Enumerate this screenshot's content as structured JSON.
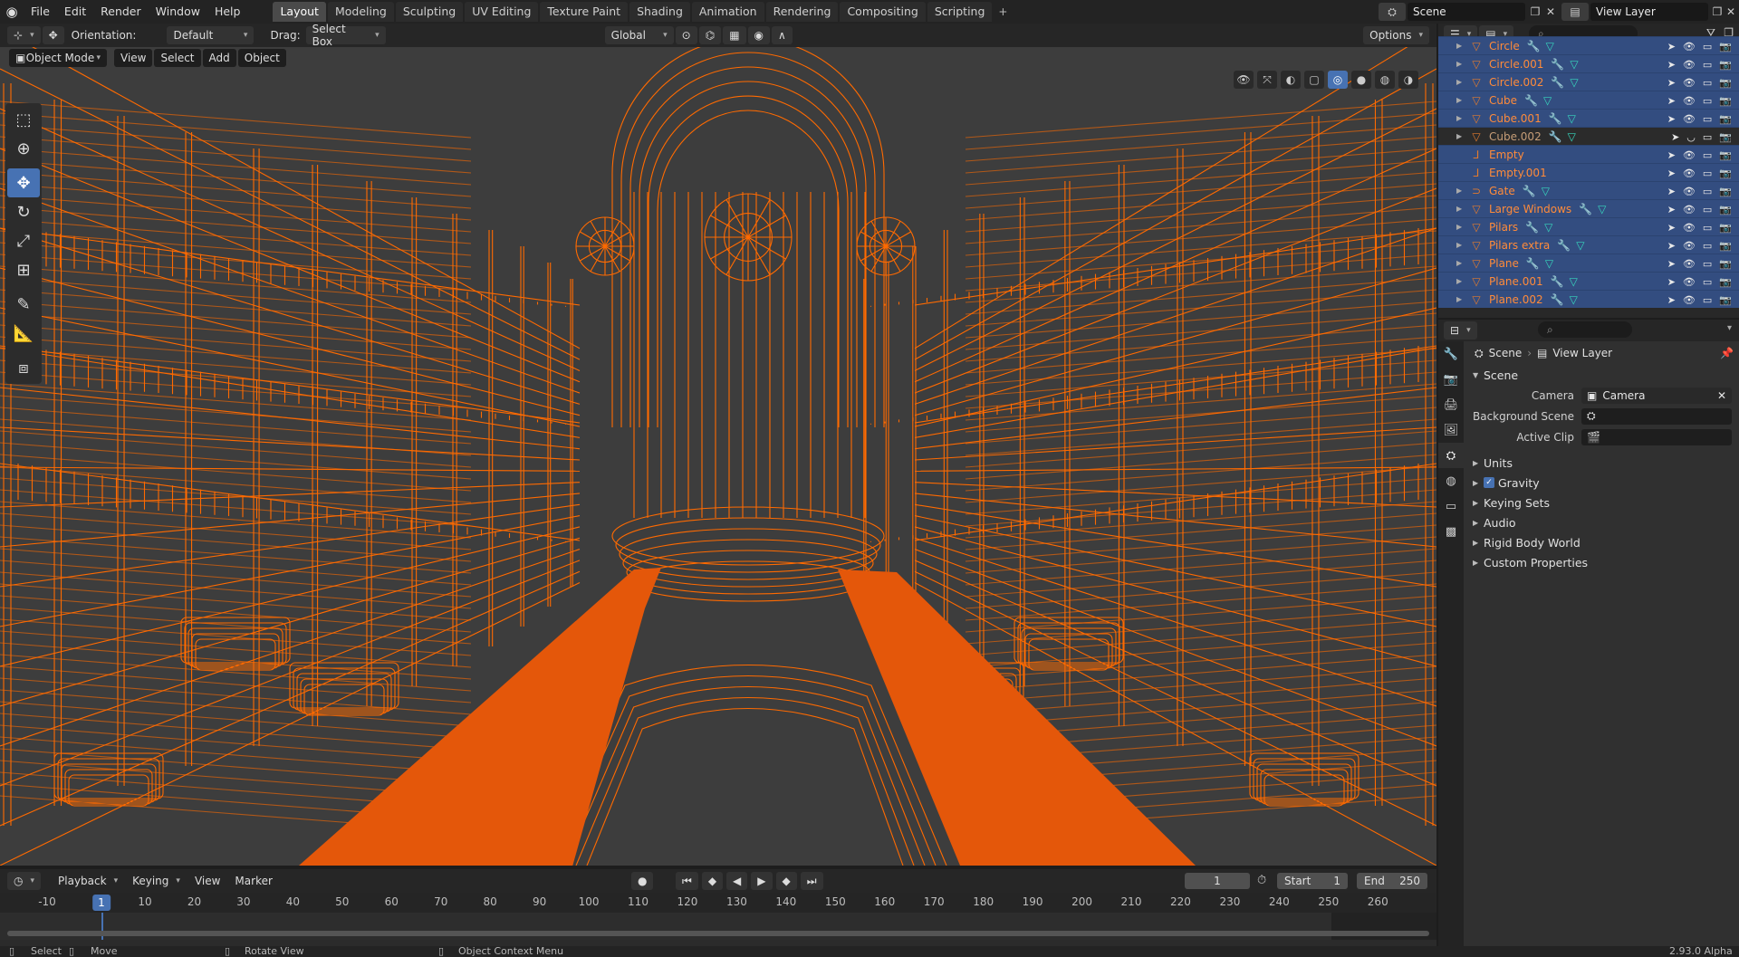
{
  "topbar": {
    "menus": [
      "File",
      "Edit",
      "Render",
      "Window",
      "Help"
    ],
    "workspaces": [
      "Layout",
      "Modeling",
      "Sculpting",
      "UV Editing",
      "Texture Paint",
      "Shading",
      "Animation",
      "Rendering",
      "Compositing",
      "Scripting"
    ],
    "active_workspace": "Layout",
    "add_tab": "+",
    "scene": "Scene",
    "view_layer": "View Layer"
  },
  "tool_header": {
    "orientation_label": "Orientation:",
    "orientation_value": "Default",
    "drag_label": "Drag:",
    "drag_value": "Select Box",
    "transform_orientation": "Global",
    "options": "Options"
  },
  "viewport_header": {
    "mode": "Object Mode",
    "menus": [
      "View",
      "Select",
      "Add",
      "Object"
    ]
  },
  "timeline": {
    "menus": [
      "Playback",
      "Keying",
      "View",
      "Marker"
    ],
    "current_frame": "1",
    "start_label": "Start",
    "start": "1",
    "end_label": "End",
    "end": "250",
    "ruler": [
      "-10",
      "1",
      "10",
      "20",
      "30",
      "40",
      "50",
      "60",
      "70",
      "80",
      "90",
      "100",
      "110",
      "120",
      "130",
      "140",
      "150",
      "160",
      "170",
      "180",
      "190",
      "200",
      "210",
      "220",
      "230",
      "240",
      "250",
      "260"
    ]
  },
  "statusbar": {
    "select": "Select",
    "move": "Move",
    "rotate": "Rotate View",
    "context": "Object Context Menu",
    "version": "2.93.0 Alpha"
  },
  "outliner": {
    "items": [
      {
        "name": "Circle",
        "icon": "mesh-icon",
        "selected": true
      },
      {
        "name": "Circle.001",
        "icon": "mesh-icon",
        "selected": true
      },
      {
        "name": "Circle.002",
        "icon": "mesh-icon",
        "selected": true
      },
      {
        "name": "Cube",
        "icon": "mesh-icon",
        "selected": true
      },
      {
        "name": "Cube.001",
        "icon": "mesh-icon",
        "selected": true
      },
      {
        "name": "Cube.002",
        "icon": "mesh-icon",
        "selected": false
      },
      {
        "name": "Empty",
        "icon": "empty-icon",
        "selected": true
      },
      {
        "name": "Empty.001",
        "icon": "empty-icon",
        "selected": true
      },
      {
        "name": "Gate",
        "icon": "curve-icon",
        "selected": true
      },
      {
        "name": "Large Windows",
        "icon": "mesh-icon",
        "selected": true
      },
      {
        "name": "Pilars",
        "icon": "mesh-icon",
        "selected": true
      },
      {
        "name": "Pilars extra",
        "icon": "mesh-icon",
        "selected": true
      },
      {
        "name": "Plane",
        "icon": "mesh-icon",
        "selected": true
      },
      {
        "name": "Plane.001",
        "icon": "mesh-icon",
        "selected": true
      },
      {
        "name": "Plane.002",
        "icon": "mesh-icon",
        "selected": true
      }
    ]
  },
  "properties": {
    "crumb_scene": "Scene",
    "crumb_viewlayer": "View Layer",
    "panel_scene": "Scene",
    "camera_label": "Camera",
    "camera_value": "Camera",
    "bg_scene_label": "Background Scene",
    "active_clip_label": "Active Clip",
    "units": "Units",
    "gravity": "Gravity",
    "keying_sets": "Keying Sets",
    "audio": "Audio",
    "rigid_body": "Rigid Body World",
    "custom_props": "Custom Properties"
  },
  "colors": {
    "accent": "#4772b3",
    "wire": "#ff6a00",
    "floor": "#e4570a",
    "viewport_bg": "#3d3d3d"
  }
}
